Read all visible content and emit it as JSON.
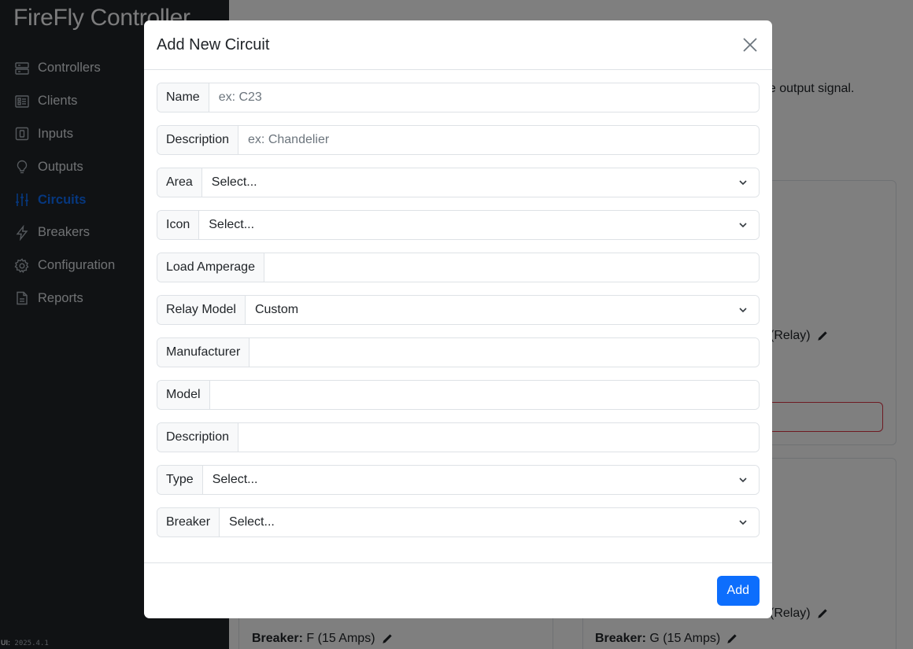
{
  "app": {
    "brand": "FireFly Controller",
    "version_label": "UI:",
    "version": "2025.4.1"
  },
  "sidebar": {
    "items": [
      {
        "label": "Controllers",
        "icon": "server-icon"
      },
      {
        "label": "Clients",
        "icon": "grid-icon"
      },
      {
        "label": "Inputs",
        "icon": "input-icon"
      },
      {
        "label": "Outputs",
        "icon": "lightbulb-icon"
      },
      {
        "label": "Circuits",
        "icon": "sliders-icon",
        "active": true
      },
      {
        "label": "Breakers",
        "icon": "lightning-icon"
      },
      {
        "label": "Configuration",
        "icon": "gear-icon"
      },
      {
        "label": "Reports",
        "icon": "document-icon"
      }
    ]
  },
  "background": {
    "partial_text": "ge output signal.",
    "relay_text_1": "(Relay)",
    "relay_text_2": "(Relay)",
    "breaker_f_label": "Breaker:",
    "breaker_f_value": "F (15 Amps)",
    "breaker_g_label": "Breaker:",
    "breaker_g_value": "G (15 Amps)"
  },
  "modal": {
    "title": "Add New Circuit",
    "fields": {
      "name": {
        "label": "Name",
        "placeholder": "ex: C23"
      },
      "description": {
        "label": "Description",
        "placeholder": "ex: Chandelier"
      },
      "area": {
        "label": "Area",
        "value": "Select..."
      },
      "icon": {
        "label": "Icon",
        "value": "Select..."
      },
      "load_amperage": {
        "label": "Load Amperage",
        "value": ""
      },
      "relay_model": {
        "label": "Relay Model",
        "value": "Custom"
      },
      "manufacturer": {
        "label": "Manufacturer",
        "value": ""
      },
      "model": {
        "label": "Model",
        "value": ""
      },
      "relay_description": {
        "label": "Description",
        "value": ""
      },
      "type": {
        "label": "Type",
        "value": "Select..."
      },
      "breaker": {
        "label": "Breaker",
        "value": "Select..."
      }
    },
    "add_label": "Add"
  },
  "colors": {
    "primary": "#0d6efd",
    "sidebar_bg": "#212529",
    "danger": "#dc3545"
  }
}
